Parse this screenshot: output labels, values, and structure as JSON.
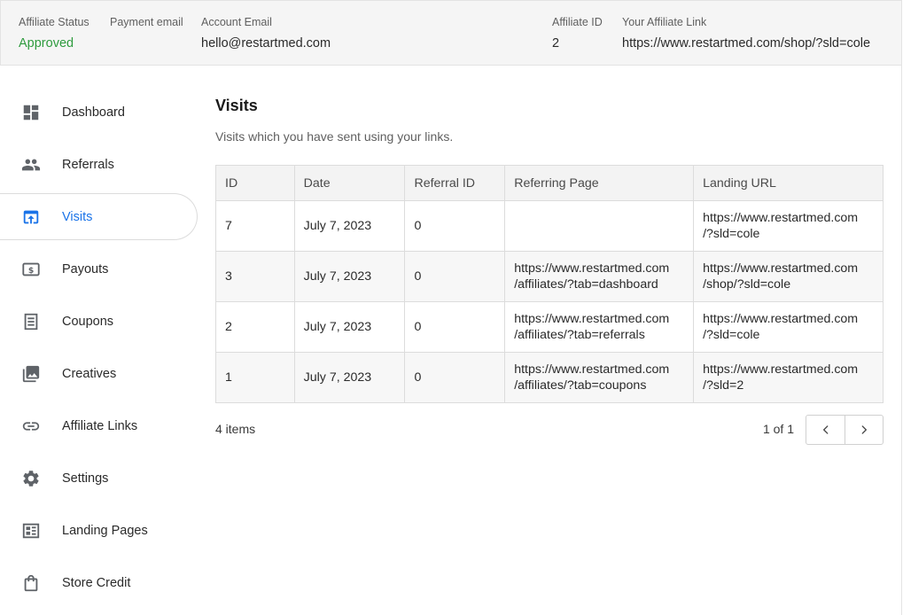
{
  "header": {
    "affiliate_status_label": "Affiliate Status",
    "affiliate_status_value": "Approved",
    "payment_email_label": "Payment email",
    "account_email_label": "Account Email",
    "account_email_value": "hello@restartmed.com",
    "affiliate_id_label": "Affiliate ID",
    "affiliate_id_value": "2",
    "affiliate_link_label": "Your Affiliate Link",
    "affiliate_link_value": "https://www.restartmed.com/shop/?sld=cole"
  },
  "colors": {
    "accent": "#1a73e8",
    "approved": "#2e9b3e",
    "icon": "#5f6368"
  },
  "sidebar": {
    "items": [
      {
        "label": "Dashboard",
        "icon": "dashboard-icon"
      },
      {
        "label": "Referrals",
        "icon": "people-icon"
      },
      {
        "label": "Visits",
        "icon": "visits-icon",
        "active": true
      },
      {
        "label": "Payouts",
        "icon": "payouts-icon"
      },
      {
        "label": "Coupons",
        "icon": "coupon-icon"
      },
      {
        "label": "Creatives",
        "icon": "image-icon"
      },
      {
        "label": "Affiliate Links",
        "icon": "link-icon"
      },
      {
        "label": "Settings",
        "icon": "gear-icon"
      },
      {
        "label": "Landing Pages",
        "icon": "landing-page-icon"
      },
      {
        "label": "Store Credit",
        "icon": "shopping-bag-icon"
      }
    ]
  },
  "main": {
    "title": "Visits",
    "description": "Visits which you have sent using your links.",
    "table": {
      "columns": [
        "ID",
        "Date",
        "Referral ID",
        "Referring Page",
        "Landing URL"
      ],
      "rows": [
        {
          "id": "7",
          "date": "July 7, 2023",
          "referral_id": "0",
          "referring_page": [
            "",
            ""
          ],
          "landing_url": [
            "https://www.restartmed.com",
            "/?sld=cole"
          ]
        },
        {
          "id": "3",
          "date": "July 7, 2023",
          "referral_id": "0",
          "referring_page": [
            "https://www.restartmed.com",
            "/affiliates/?tab=dashboard"
          ],
          "landing_url": [
            "https://www.restartmed.com",
            "/shop/?sld=cole"
          ]
        },
        {
          "id": "2",
          "date": "July 7, 2023",
          "referral_id": "0",
          "referring_page": [
            "https://www.restartmed.com",
            "/affiliates/?tab=referrals"
          ],
          "landing_url": [
            "https://www.restartmed.com",
            "/?sld=cole"
          ]
        },
        {
          "id": "1",
          "date": "July 7, 2023",
          "referral_id": "0",
          "referring_page": [
            "https://www.restartmed.com",
            "/affiliates/?tab=coupons"
          ],
          "landing_url": [
            "https://www.restartmed.com",
            "/?sld=2"
          ]
        }
      ]
    },
    "items_count": "4 items",
    "pager_text": "1 of 1"
  }
}
